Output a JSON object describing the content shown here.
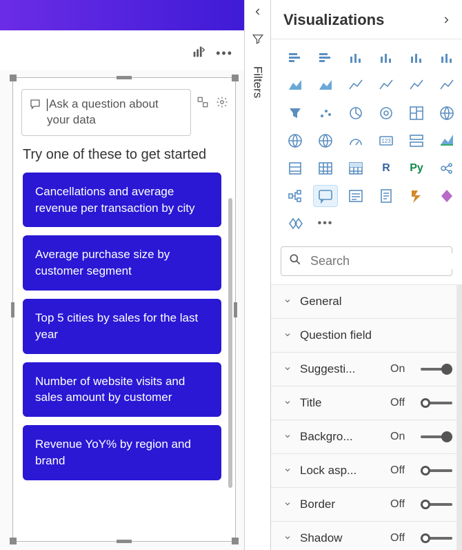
{
  "canvas": {
    "qa_placeholder": "Ask a question about your data",
    "try_label": "Try one of these to get started",
    "suggestions": [
      "Cancellations and average revenue per transaction by city",
      "Average purchase size by customer segment",
      "Top 5 cities by sales for the last year",
      "Number of website visits and sales amount by customer",
      "Revenue YoY% by region and brand"
    ]
  },
  "filters": {
    "label": "Filters"
  },
  "viz": {
    "title": "Visualizations",
    "search_placeholder": "Search",
    "icons": [
      "stacked-bar",
      "clustered-bar",
      "stacked-column",
      "clustered-column",
      "stacked-column-100",
      "line",
      "area",
      "stacked-area",
      "line-clustered",
      "line-stacked",
      "ribbon",
      "waterfall",
      "funnel",
      "scatter",
      "pie",
      "donut",
      "treemap",
      "map",
      "filled-map",
      "shape-map",
      "gauge",
      "card",
      "multi-row-card",
      "kpi",
      "slicer",
      "table",
      "matrix",
      "r-visual",
      "python-visual",
      "key-influencers",
      "decomposition-tree",
      "qna",
      "smart-narrative",
      "paginated",
      "power-automate",
      "power-apps",
      "more-visuals",
      "more-options"
    ],
    "selected_icon": "qna",
    "format": [
      {
        "name": "General",
        "toggle": null
      },
      {
        "name": "Question field",
        "toggle": null
      },
      {
        "name": "Suggesti...",
        "state": "On",
        "on": true
      },
      {
        "name": "Title",
        "state": "Off",
        "on": false
      },
      {
        "name": "Backgro...",
        "state": "On",
        "on": true
      },
      {
        "name": "Lock asp...",
        "state": "Off",
        "on": false
      },
      {
        "name": "Border",
        "state": "Off",
        "on": false
      },
      {
        "name": "Shadow",
        "state": "Off",
        "on": false
      }
    ]
  }
}
